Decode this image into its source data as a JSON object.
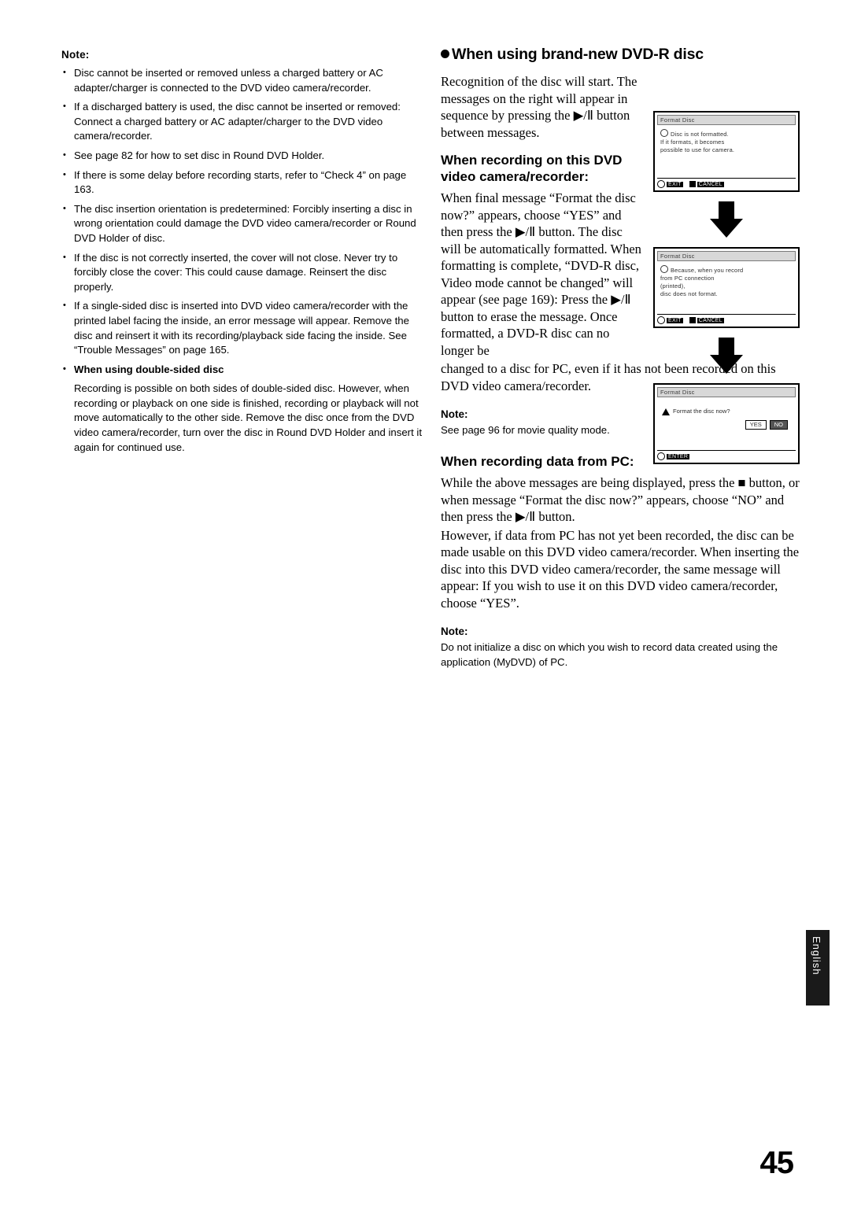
{
  "page": {
    "number": "45",
    "side_tab_label": "English"
  },
  "left_column": {
    "note_heading": "Note:",
    "bullets": [
      "Disc cannot be inserted or removed unless a charged battery or AC adapter/charger is connected to the DVD video camera/recorder.",
      "If a discharged battery is used, the disc cannot be inserted or removed: Connect a charged battery or AC adapter/charger to the DVD video camera/recorder.",
      "See page 82 for how to set disc in Round DVD Holder.",
      "If there is some delay before recording starts, refer to “Check 4” on page 163.",
      "The disc insertion orientation is predetermined: Forcibly inserting a disc in wrong orientation could damage the DVD video camera/recorder or Round DVD Holder of disc.",
      "If the disc is not correctly inserted, the cover will not close. Never try to forcibly close the cover: This could cause damage. Reinsert the disc properly.",
      "If a single-sided disc is inserted into DVD video camera/recorder with the printed label facing the inside, an error message will appear. Remove the disc and reinsert it with its recording/playback side facing the inside. See “Trouble Messages” on page 165."
    ],
    "sub_bullet_heading": "When using double-sided disc",
    "sub_bullet_body": "Recording is possible on both sides of double-sided disc. However, when recording or playback on one side is finished, recording or playback will not move automatically to the other side. Remove the disc once from the DVD video camera/recorder, turn over the disc in Round DVD Holder and insert it again for continued use."
  },
  "right_column": {
    "section_title": "When using brand-new DVD-R disc",
    "intro_paragraph": "Recognition of the disc will start. The messages on the right will appear in sequence by pressing the ▶/Ⅱ button between messages.",
    "heading_recording_on": "When recording on this DVD video camera/recorder:",
    "body_recording_on_1": "When final message “Format the disc now?” appears, choose “YES” and then press the ▶/Ⅱ button. The disc will be automatically formatted. When formatting is complete, “DVD-R disc, Video mode cannot be changed” will appear (see page 169): Press the ▶/Ⅱ button to erase the message. Once formatted, a DVD-R disc can no longer be",
    "body_recording_on_2": "changed to a disc for PC, even if it has not been recorded on this DVD video camera/recorder.",
    "note_1": {
      "heading": "Note:",
      "body": "See page 96 for movie quality mode."
    },
    "heading_recording_pc": "When recording data from PC:",
    "body_recording_pc_1": "While the above messages are being displayed, press the ■ button, or when message “Format the disc now?” appears, choose “NO” and then press the ▶/Ⅱ button.",
    "body_recording_pc_2": "However, if data from PC has not yet been recorded, the disc can be made usable on this DVD video camera/recorder. When inserting the disc into this DVD video camera/recorder, the same message will appear: If you wish to use it on this DVD video camera/recorder, choose “YES”.",
    "note_2": {
      "heading": "Note:",
      "body": "Do not initialize a disc on which you wish to record data created using the application (MyDVD) of PC."
    }
  },
  "screens": [
    {
      "id": "screen-1",
      "title": "Format Disc",
      "lines": [
        "Disc is not formatted.",
        "If it formats, it becomes",
        "possible to use for camera."
      ],
      "footer": [
        {
          "key": "circle",
          "label": "EXIT"
        },
        {
          "key": "square",
          "label": "CANCEL"
        }
      ]
    },
    {
      "id": "screen-2",
      "title": "Format Disc",
      "lines": [
        "Because, when you record",
        "from PC connection",
        "(printed),",
        "disc does not format."
      ],
      "footer": [
        {
          "key": "circle",
          "label": "EXIT"
        },
        {
          "key": "square",
          "label": "CANCEL"
        }
      ]
    },
    {
      "id": "screen-3",
      "title": "Format Disc",
      "warning": "Format the disc now?",
      "buttons": [
        {
          "label": "YES",
          "selected": false
        },
        {
          "label": "NO",
          "selected": true
        }
      ],
      "footer": [
        {
          "key": "circle",
          "label": "ENTER"
        }
      ]
    }
  ]
}
